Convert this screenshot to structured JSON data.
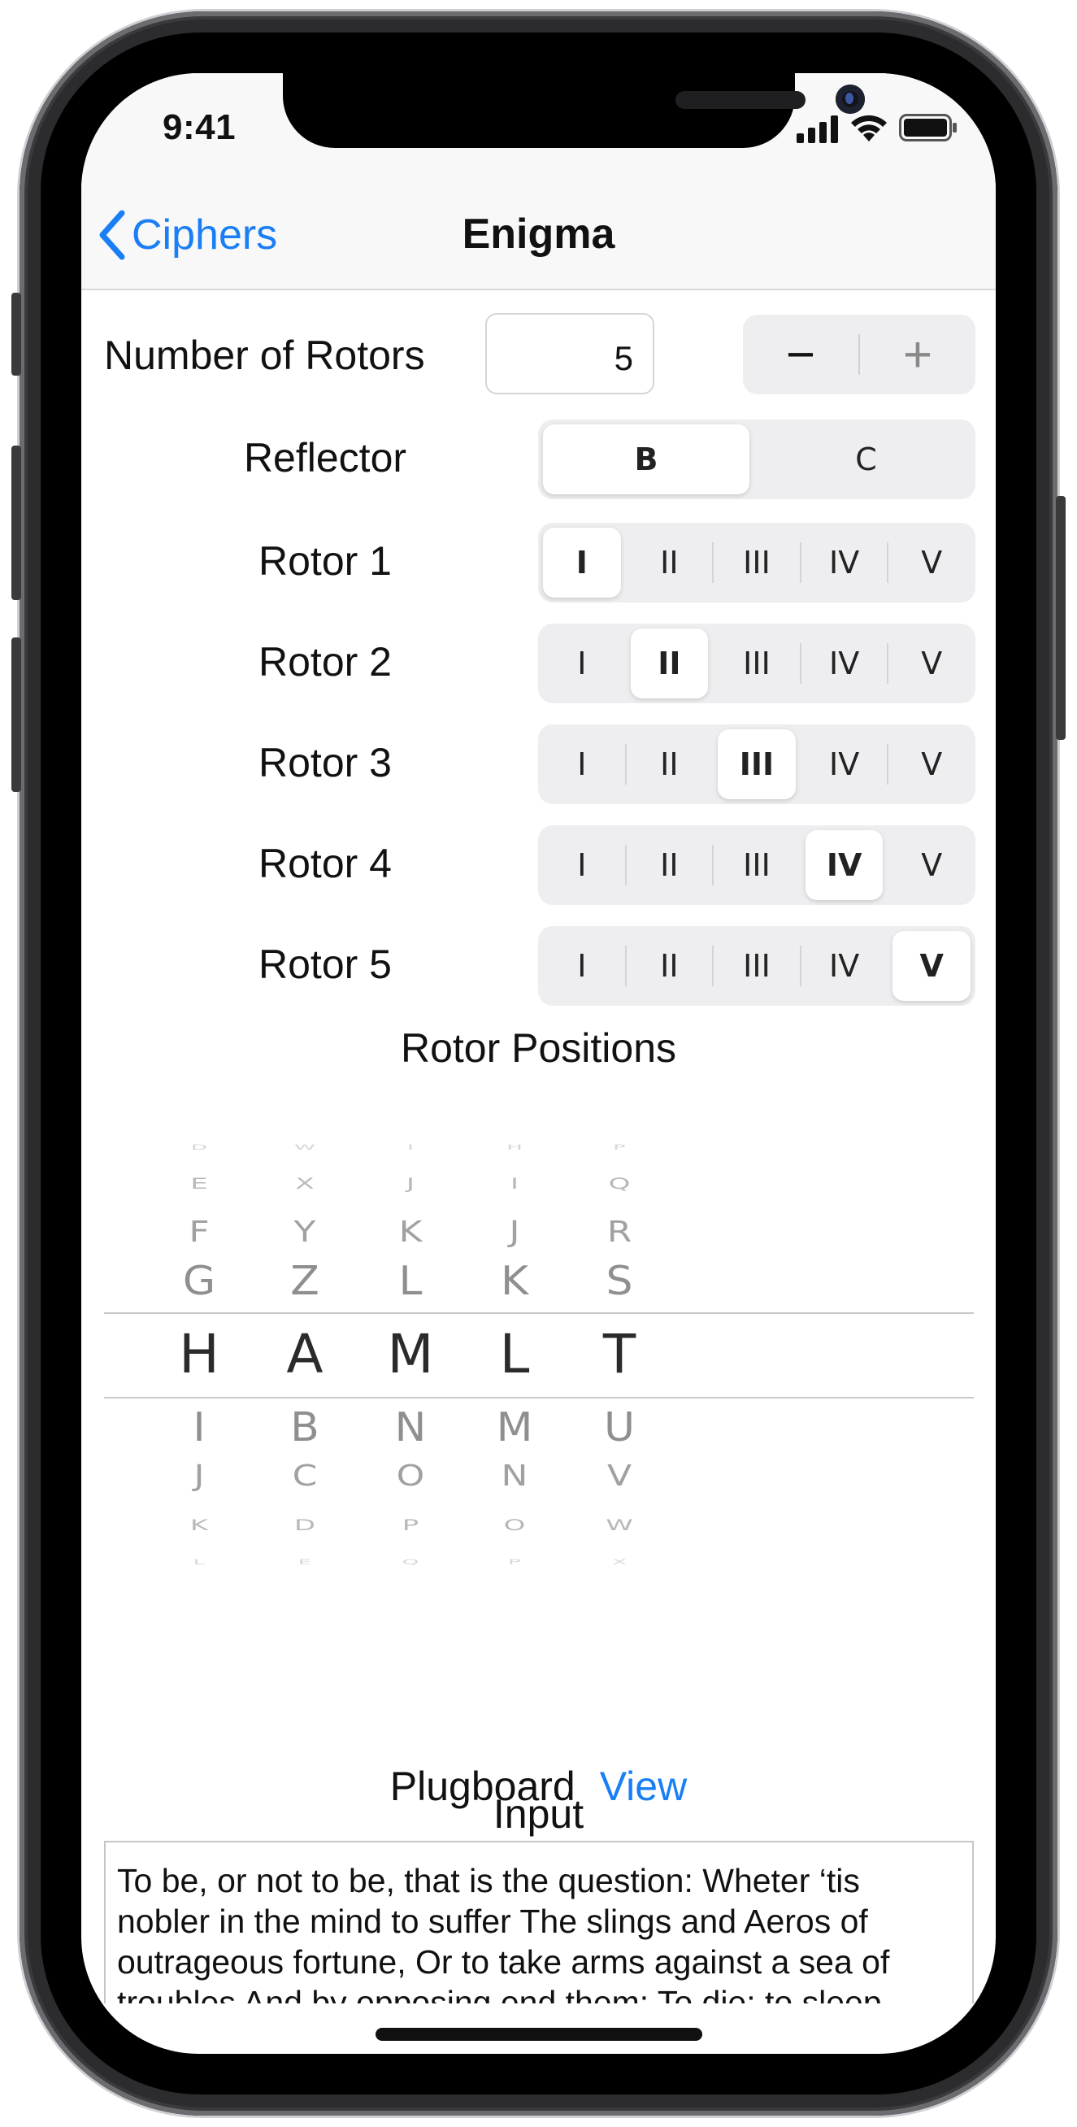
{
  "status": {
    "time": "9:41"
  },
  "nav": {
    "back_label": "Ciphers",
    "title": "Enigma"
  },
  "rotor_count": {
    "label": "Number of Rotors",
    "value": "5",
    "minus": "−",
    "plus": "+"
  },
  "reflector": {
    "label": "Reflector",
    "options": [
      "B",
      "C"
    ],
    "selected": "B"
  },
  "rotors": [
    {
      "label": "Rotor 1",
      "selected": "I"
    },
    {
      "label": "Rotor 2",
      "selected": "II"
    },
    {
      "label": "Rotor 3",
      "selected": "III"
    },
    {
      "label": "Rotor 4",
      "selected": "IV"
    },
    {
      "label": "Rotor 5",
      "selected": "V"
    }
  ],
  "rotor_options": [
    "I",
    "II",
    "III",
    "IV",
    "V"
  ],
  "rotor_positions": {
    "label": "Rotor Positions",
    "columns": [
      {
        "above": [
          "D",
          "E",
          "F",
          "G"
        ],
        "selected": "H",
        "below": [
          "I",
          "J",
          "K",
          "L"
        ]
      },
      {
        "above": [
          "W",
          "X",
          "Y",
          "Z"
        ],
        "selected": "A",
        "below": [
          "B",
          "C",
          "D",
          "E"
        ]
      },
      {
        "above": [
          "I",
          "J",
          "K",
          "L"
        ],
        "selected": "M",
        "below": [
          "N",
          "O",
          "P",
          "Q"
        ]
      },
      {
        "above": [
          "H",
          "I",
          "J",
          "K"
        ],
        "selected": "L",
        "below": [
          "M",
          "N",
          "O",
          "P"
        ]
      },
      {
        "above": [
          "P",
          "Q",
          "R",
          "S"
        ],
        "selected": "T",
        "below": [
          "U",
          "V",
          "W",
          "X"
        ]
      }
    ]
  },
  "plugboard": {
    "label": "Plugboard",
    "link": "View"
  },
  "input": {
    "label": "Input",
    "text": "To be, or not to be, that is the question: Wheter ‘tis nobler in the mind to suffer The slings and Aeros of outrageous fortune, Or to take arms against a sea of troubles And by opposing end them: To die: to sleep"
  }
}
